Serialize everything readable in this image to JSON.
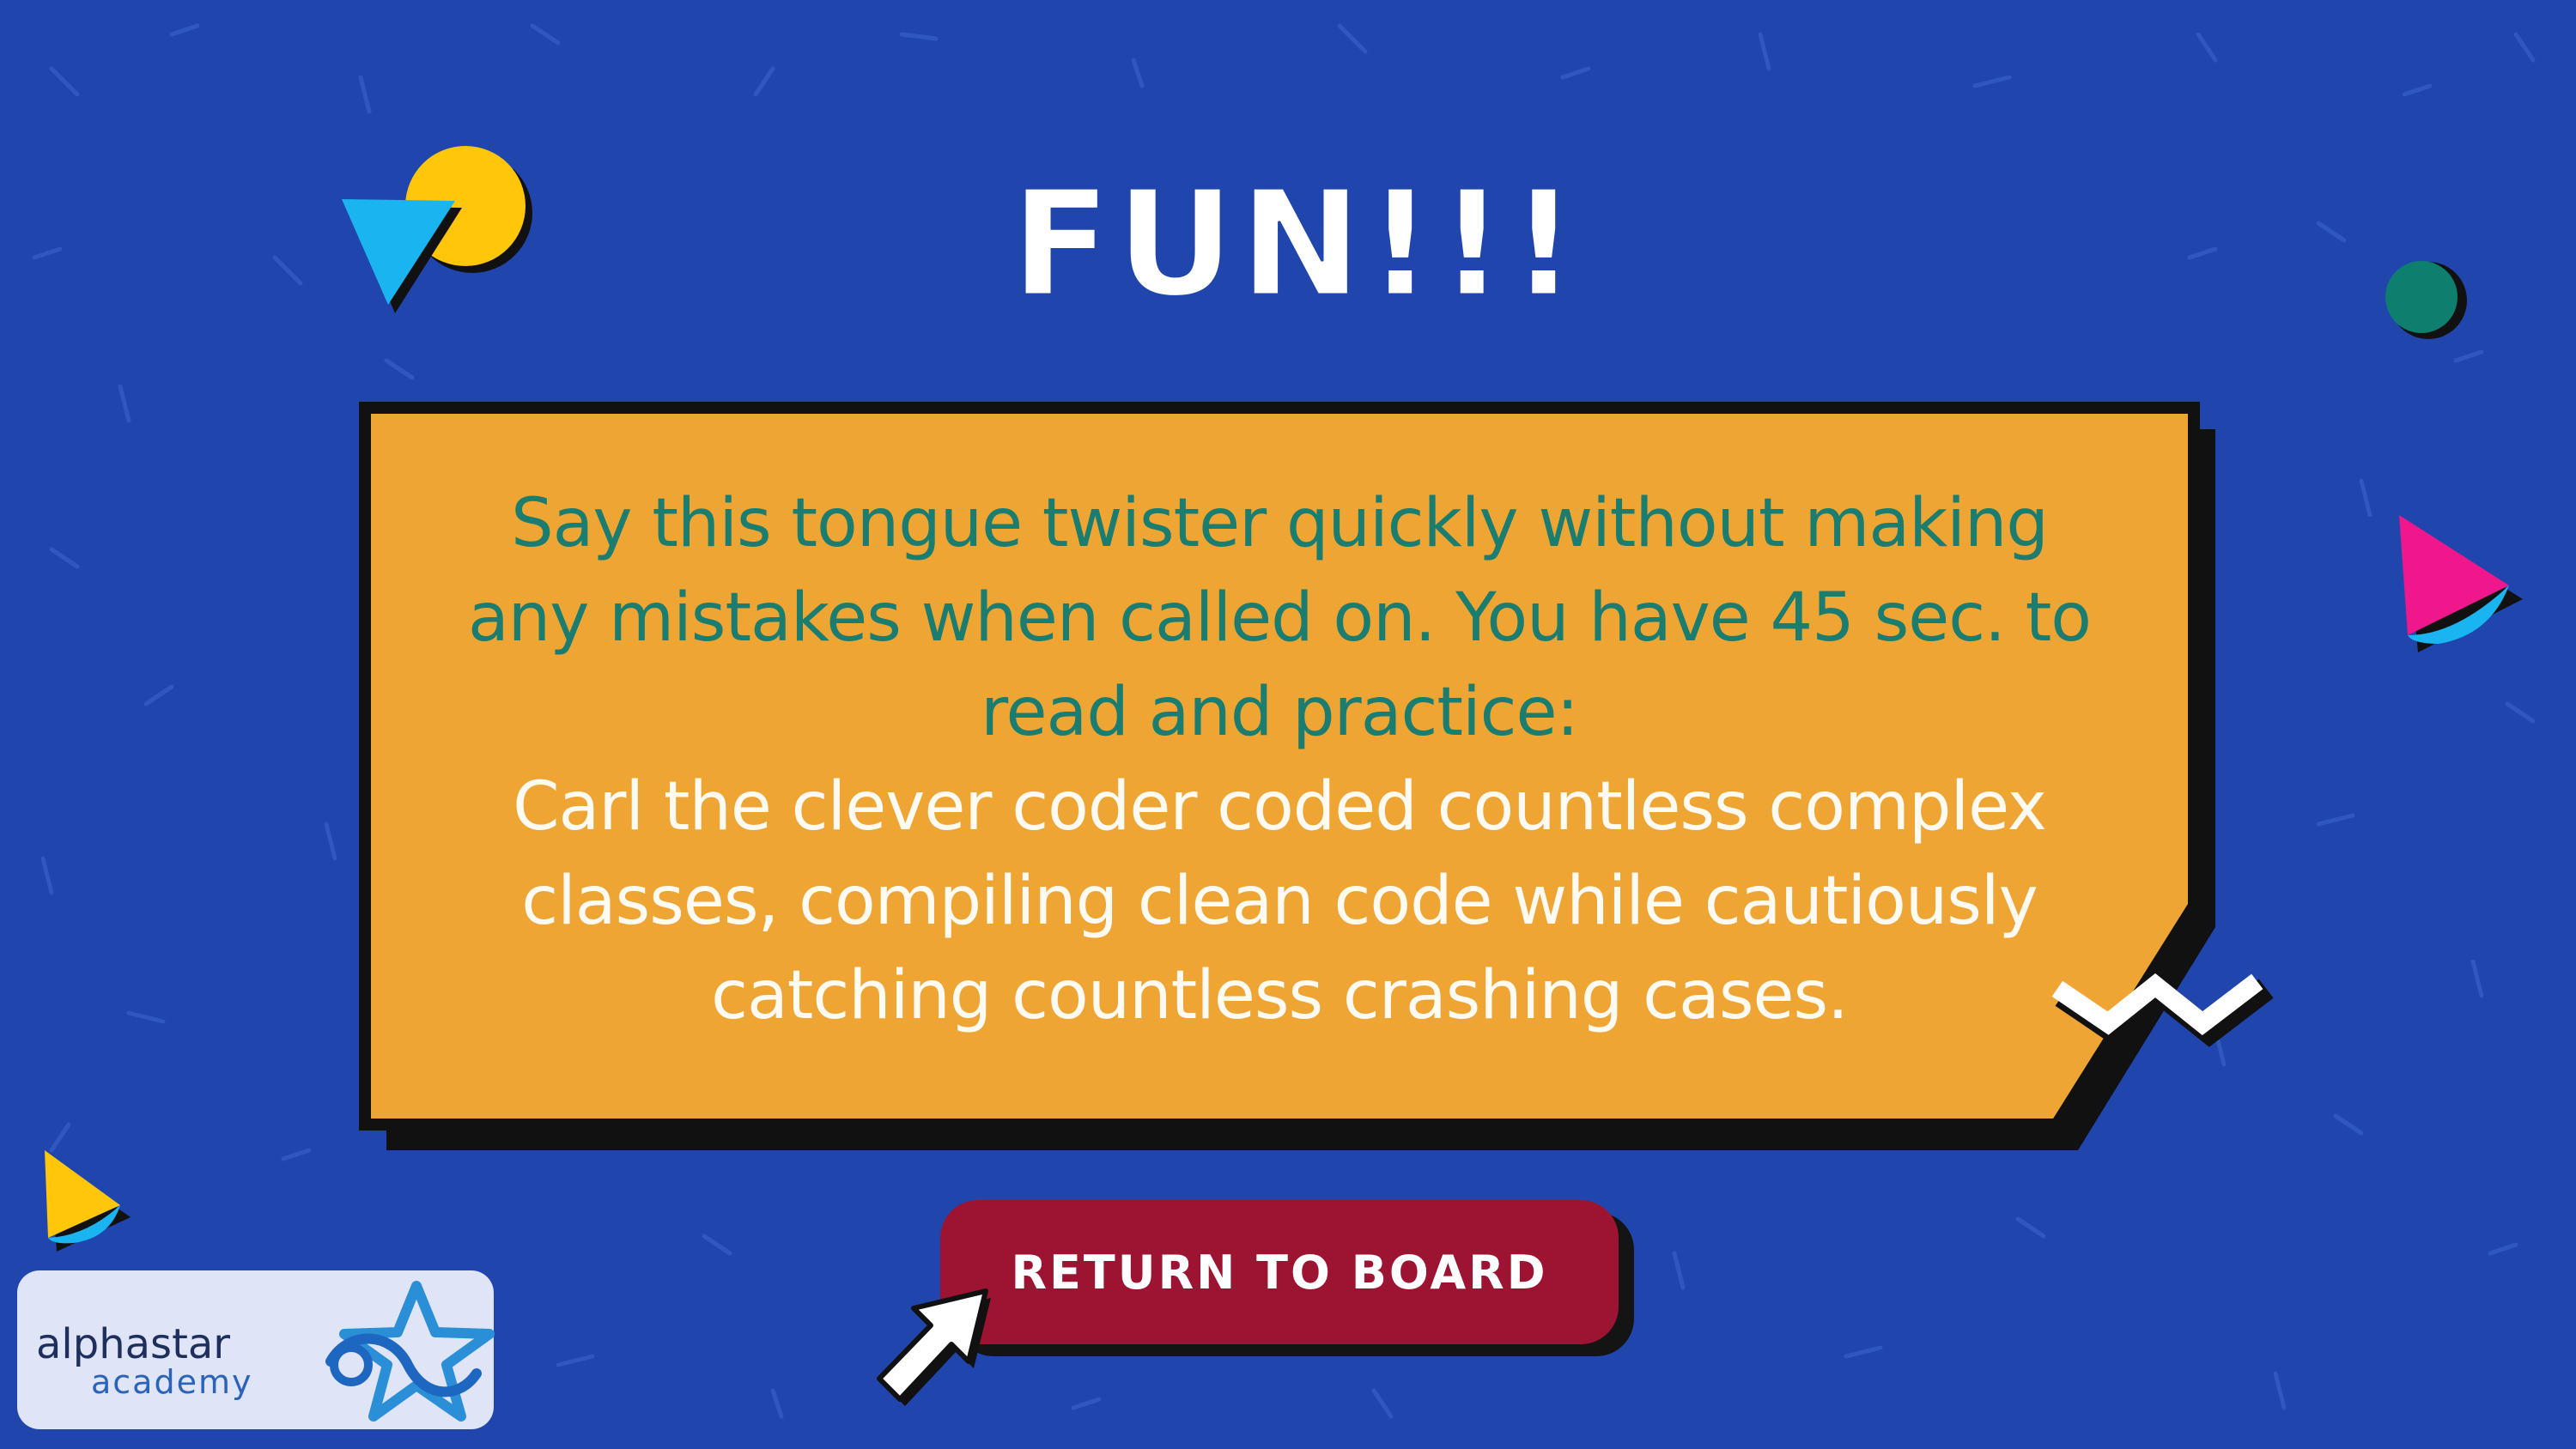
{
  "slide": {
    "title": "FUN!!!",
    "prompt_lines": [
      "Say this tongue twister quickly without making",
      "any mistakes when called on. You have 45 sec. to",
      "read and practice:"
    ],
    "twister_lines": [
      "Carl the clever coder coded countless complex",
      "classes, compiling clean code while cautiously",
      "catching countless crashing cases."
    ]
  },
  "button": {
    "label": "RETURN TO BOARD"
  },
  "logo": {
    "name": "alphastar",
    "sub": "academy"
  },
  "colors": {
    "background": "#2046ae",
    "card": "#eea533",
    "prompt_text": "#1a7d70",
    "twister_text": "#fffaf2",
    "button": "#9c1432",
    "yellow": "#ffc60a",
    "cyan": "#1ab4f0",
    "pink": "#f0168c",
    "teal": "#0e7e6e"
  },
  "icons": [
    "cursor-arrow-icon",
    "alphastar-star-icon",
    "zigzag-icon"
  ]
}
